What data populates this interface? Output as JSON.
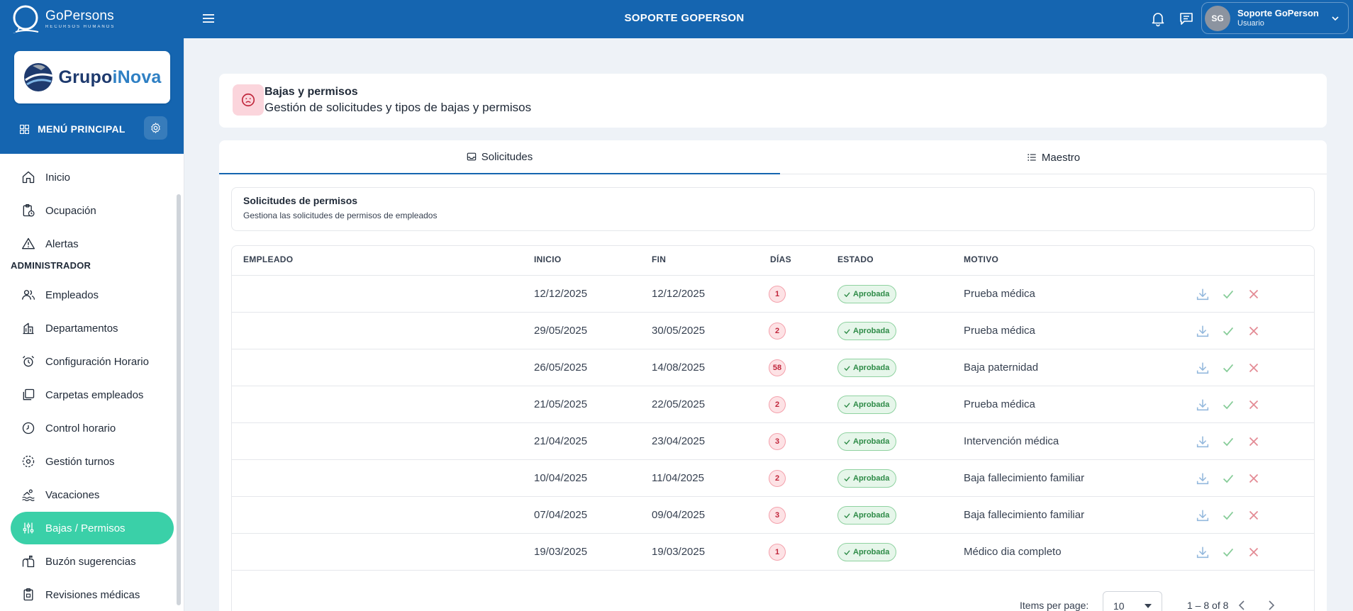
{
  "topbar": {
    "brand_name": "GoPersons",
    "brand_tagline": "Recursos Humanos",
    "title": "SOPORTE GOPERSON",
    "user": {
      "initials": "SG",
      "name": "Soporte GoPerson",
      "role": "Usuario"
    }
  },
  "sidebar": {
    "company_logo": {
      "part1": "Grupo",
      "part2": "iNova"
    },
    "main_menu_label": "MENÚ PRINCIPAL",
    "section_admin": "ADMINISTRADOR",
    "items": [
      {
        "label": "Inicio",
        "icon": "home-icon"
      },
      {
        "label": "Ocupación",
        "icon": "clipboard-clock-icon"
      },
      {
        "label": "Alertas",
        "icon": "alert-triangle-icon"
      },
      {
        "label": "Empleados",
        "icon": "users-icon"
      },
      {
        "label": "Departamentos",
        "icon": "building-icon"
      },
      {
        "label": "Configuración Horario",
        "icon": "alarm-clock-icon"
      },
      {
        "label": "Carpetas empleados",
        "icon": "folders-icon"
      },
      {
        "label": "Control horario",
        "icon": "clock-icon"
      },
      {
        "label": "Gestión turnos",
        "icon": "dashed-circle-icon"
      },
      {
        "label": "Vacaciones",
        "icon": "swimmer-icon"
      },
      {
        "label": "Bajas / Permisos",
        "icon": "sliders-icon",
        "active": true
      },
      {
        "label": "Buzón sugerencias",
        "icon": "mailbox-icon"
      },
      {
        "label": "Revisiones médicas",
        "icon": "clipboard-check-icon"
      }
    ]
  },
  "header": {
    "title": "Bajas y permisos",
    "subtitle": "Gestión de solicitudes y tipos de bajas y permisos"
  },
  "tabs": [
    {
      "label": "Solicitudes",
      "active": true
    },
    {
      "label": "Maestro",
      "active": false
    }
  ],
  "section": {
    "title": "Solicitudes de permisos",
    "subtitle": "Gestiona las solicitudes de permisos de empleados"
  },
  "table": {
    "columns": [
      "EMPLEADO",
      "INICIO",
      "FIN",
      "DÍAS",
      "ESTADO",
      "MOTIVO"
    ],
    "rows": [
      {
        "empleado": "",
        "inicio": "12/12/2025",
        "fin": "12/12/2025",
        "dias": "1",
        "estado": "Aprobada",
        "motivo": "Prueba médica"
      },
      {
        "empleado": "",
        "inicio": "29/05/2025",
        "fin": "30/05/2025",
        "dias": "2",
        "estado": "Aprobada",
        "motivo": "Prueba médica"
      },
      {
        "empleado": "",
        "inicio": "26/05/2025",
        "fin": "14/08/2025",
        "dias": "58",
        "estado": "Aprobada",
        "motivo": "Baja paternidad"
      },
      {
        "empleado": "",
        "inicio": "21/05/2025",
        "fin": "22/05/2025",
        "dias": "2",
        "estado": "Aprobada",
        "motivo": "Prueba médica"
      },
      {
        "empleado": "",
        "inicio": "21/04/2025",
        "fin": "23/04/2025",
        "dias": "3",
        "estado": "Aprobada",
        "motivo": "Intervención médica"
      },
      {
        "empleado": "",
        "inicio": "10/04/2025",
        "fin": "11/04/2025",
        "dias": "2",
        "estado": "Aprobada",
        "motivo": "Baja fallecimiento familiar"
      },
      {
        "empleado": "",
        "inicio": "07/04/2025",
        "fin": "09/04/2025",
        "dias": "3",
        "estado": "Aprobada",
        "motivo": "Baja fallecimiento familiar"
      },
      {
        "empleado": "",
        "inicio": "19/03/2025",
        "fin": "19/03/2025",
        "dias": "1",
        "estado": "Aprobada",
        "motivo": "Médico dia completo"
      }
    ]
  },
  "paginator": {
    "items_per_page_label": "Items per page:",
    "items_per_page": "10",
    "range": "1 – 8 of 8"
  },
  "colors": {
    "primary": "#1565b0",
    "active_nav": "#3ad0a8",
    "status_green": "#2e8b47",
    "days_red": "#c0263b"
  }
}
